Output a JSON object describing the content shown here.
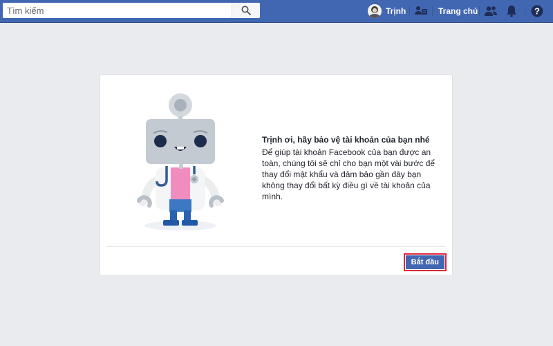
{
  "topbar": {
    "search": {
      "placeholder": "Tìm kiếm",
      "value": ""
    },
    "profile_name": "Trịnh",
    "home_label": "Trang chủ"
  },
  "card": {
    "title": "Trịnh ơi, hãy bảo vệ tài khoản của bạn nhé",
    "body": "Để giúp tài khoản Facebook của bạn được an toàn, chúng tôi sẽ chỉ cho bạn một vài bước để thay đổi mật khẩu và đảm bảo gần đây bạn không thay đổi bất kỳ điều gì về tài khoản của mình.",
    "start_button": "Bắt đầu"
  },
  "colors": {
    "brand": "#4267b2",
    "page_bg": "#e9ebee",
    "highlight": "#e0263a"
  }
}
